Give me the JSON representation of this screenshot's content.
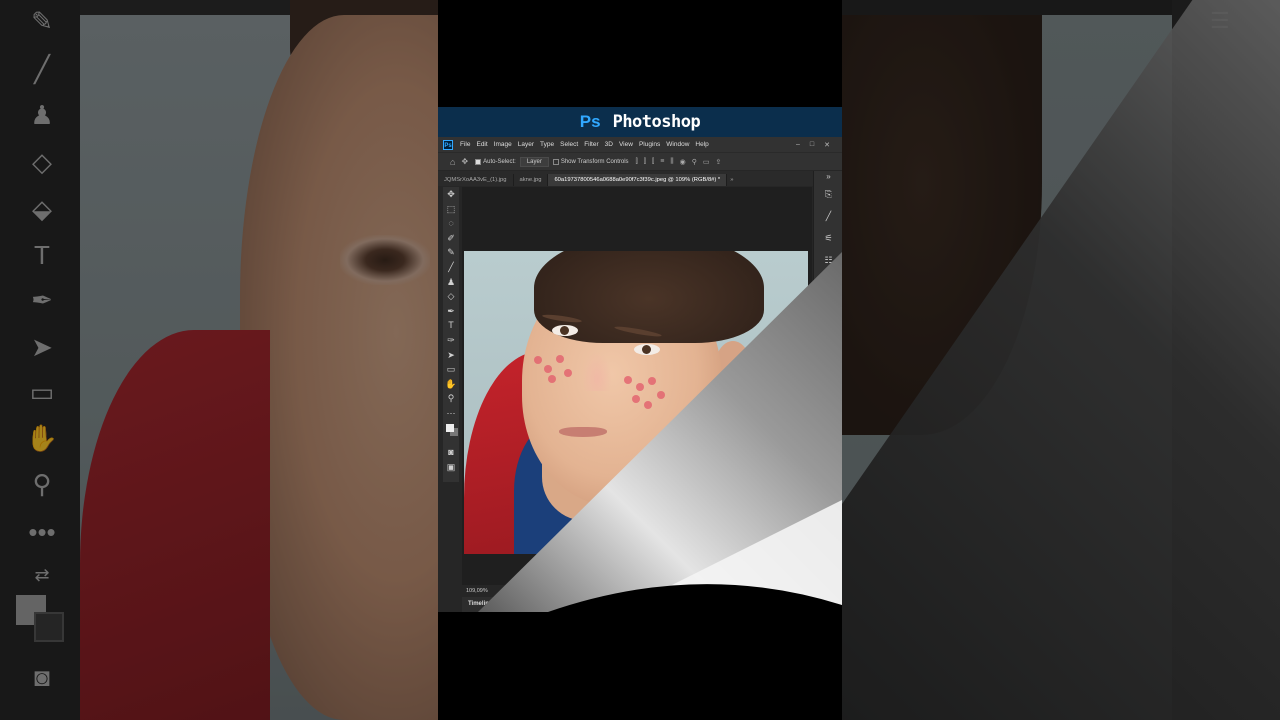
{
  "banner": {
    "ps_mark": "Ps",
    "title": "Photoshop"
  },
  "menu": {
    "logo": "Ps",
    "items": [
      "File",
      "Edit",
      "Image",
      "Layer",
      "Type",
      "Select",
      "Filter",
      "3D",
      "View",
      "Plugins",
      "Window",
      "Help"
    ],
    "window_controls": [
      "–",
      "□",
      "✕"
    ]
  },
  "options": {
    "auto_select_label": "Auto-Select:",
    "auto_select_value": "Layer",
    "transform_label": "Show Transform Controls"
  },
  "tabs": [
    {
      "label": "JQMSrXoAA3vE_(1).jpg"
    },
    {
      "label": "akne.jpg"
    },
    {
      "label": "60a19737800546a0688a0e90f7c3f39c.jpeg @ 109% (RGB/8#) *"
    }
  ],
  "tabs_overflow": "»",
  "tools": [
    "move-tool",
    "marquee-tool",
    "lasso-tool",
    "quick-selection-tool",
    "eyedropper-tool",
    "brush-tool",
    "clone-stamp-tool",
    "eraser-tool",
    "pen-tool",
    "type-tool",
    "path-selection-tool",
    "direct-selection-tool",
    "rectangle-tool",
    "hand-tool",
    "zoom-tool",
    "more-tools",
    "swap-colors",
    "color-swatches",
    "quick-mask",
    "screen-mode"
  ],
  "status": {
    "zoom": "109,09%"
  },
  "timeline": {
    "label": "Timeline"
  },
  "colors": {
    "ps_blue": "#31a8ff",
    "banner_bg": "#0b2e4c",
    "panel_bg": "#323232",
    "canvas_bg": "#1f1f1f"
  }
}
